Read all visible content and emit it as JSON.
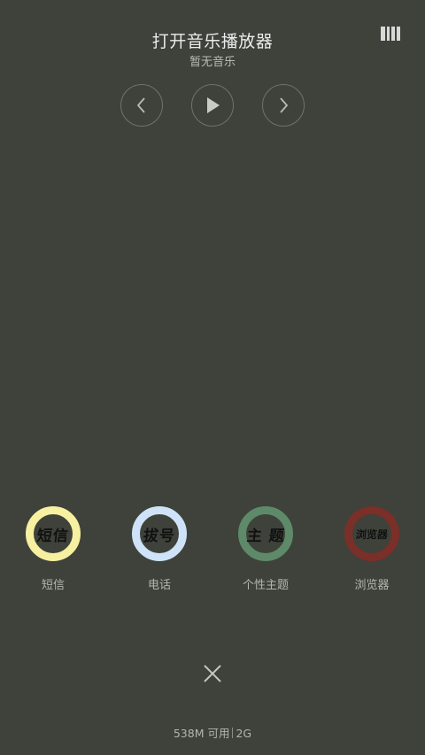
{
  "player": {
    "title": "打开音乐播放器",
    "subtitle": "暂无音乐"
  },
  "controls": {
    "prev_icon": "chevron-left-icon",
    "play_icon": "play-icon",
    "next_icon": "chevron-right-icon",
    "menu_icon": "manage-apps-icon"
  },
  "apps": [
    {
      "label": "短信",
      "icon_text": "短信",
      "color": "#f6f0a0"
    },
    {
      "label": "电话",
      "icon_text": "拔号",
      "color": "#cfe3f8"
    },
    {
      "label": "个性主题",
      "icon_text": "主 题",
      "color": "#5e8a6a"
    },
    {
      "label": "浏览器",
      "icon_text": "浏览器",
      "color": "#7a2f28"
    }
  ],
  "close_icon": "close-icon",
  "status": {
    "memory": "538M 可用",
    "network": "2G"
  }
}
